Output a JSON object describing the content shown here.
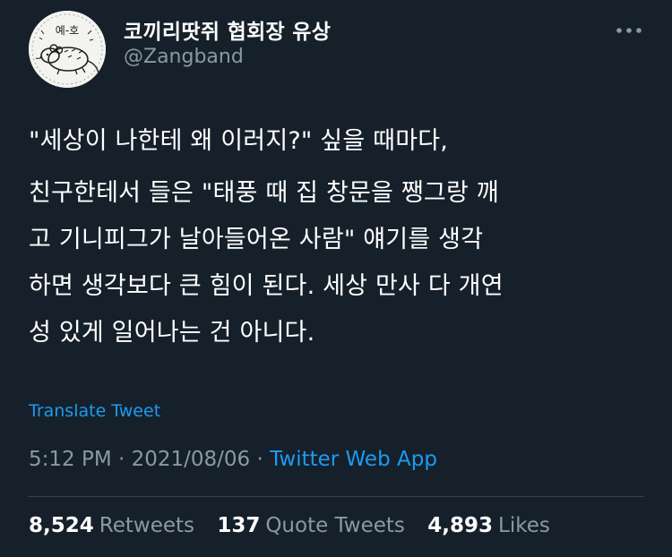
{
  "author": {
    "display_name": "코끼리땃쥐 협회장 유상",
    "handle": "@Zangband",
    "avatar_icon": "mouse-sketch-avatar-icon",
    "avatar_text": "예-호"
  },
  "more_icon": "ellipsis-icon",
  "tweet": {
    "paragraphs": [
      "\"세상이 나한테 왜 이러지?\" 싶을 때마다,",
      "친구한테서 들은 \"태풍 때 집 창문을 쨍그랑 깨\n고 기니피그가 날아들어온 사람\" 얘기를 생각\n하면 생각보다 큰 힘이 된다. 세상 만사 다 개연\n성 있게 일어나는 건 아니다."
    ]
  },
  "translate_label": "Translate Tweet",
  "meta": {
    "time": "5:12 PM",
    "separator": " · ",
    "date": "2021/08/06",
    "source": "Twitter Web App"
  },
  "stats": {
    "retweets": {
      "count": "8,524",
      "label": "Retweets"
    },
    "quotes": {
      "count": "137",
      "label": "Quote Tweets"
    },
    "likes": {
      "count": "4,893",
      "label": "Likes"
    }
  },
  "colors": {
    "background": "#15202b",
    "accent": "#1d9bf0",
    "secondary_text": "#8b98a5",
    "divider": "#38444d"
  }
}
